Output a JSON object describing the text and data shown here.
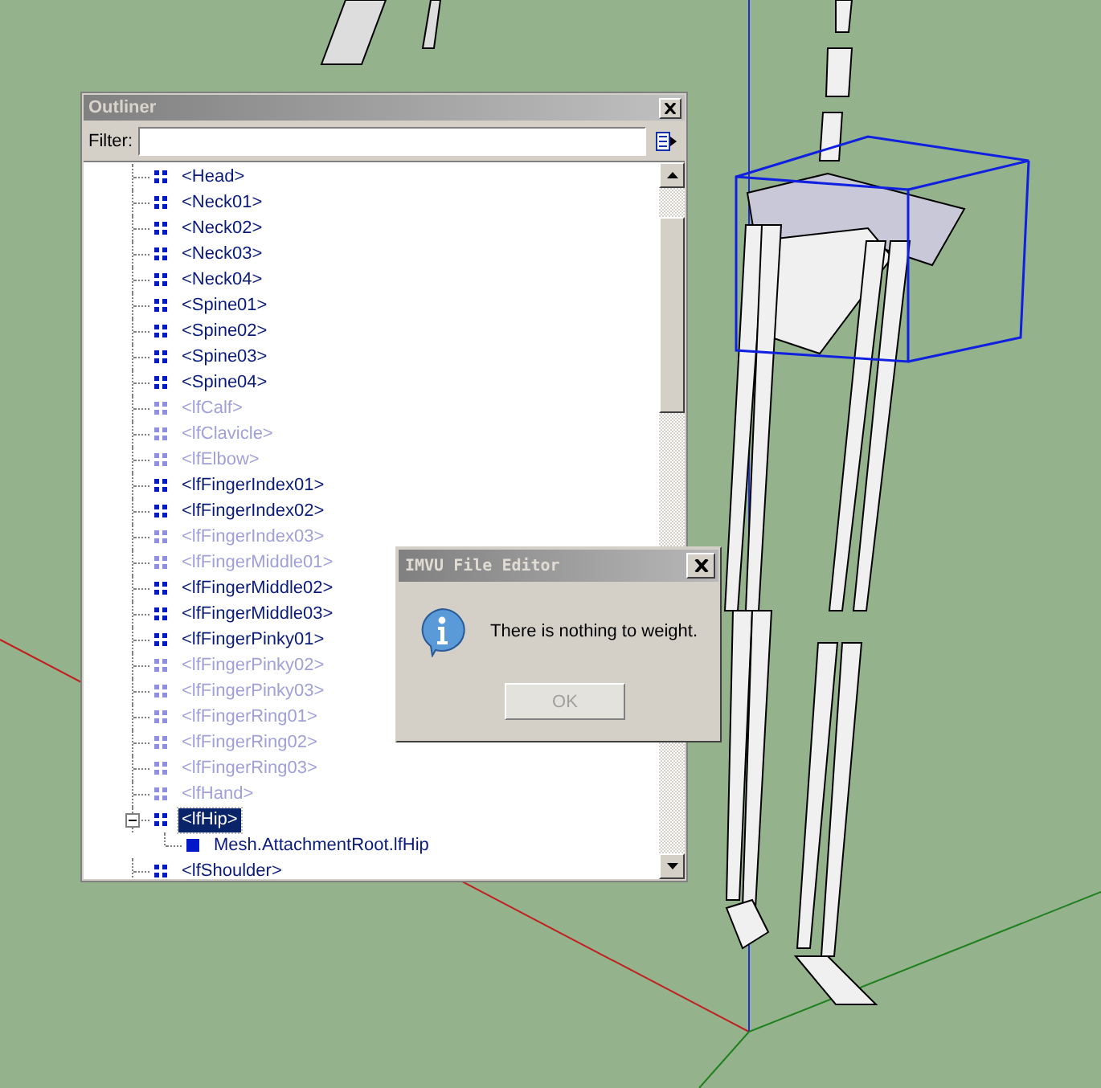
{
  "outliner": {
    "title": "Outliner",
    "filter": {
      "label": "Filter:"
    },
    "items": [
      {
        "label": "<Head>",
        "hidden": false,
        "selected": false
      },
      {
        "label": "<Neck01>",
        "hidden": false,
        "selected": false
      },
      {
        "label": "<Neck02>",
        "hidden": false,
        "selected": false
      },
      {
        "label": "<Neck03>",
        "hidden": false,
        "selected": false
      },
      {
        "label": "<Neck04>",
        "hidden": false,
        "selected": false
      },
      {
        "label": "<Spine01>",
        "hidden": false,
        "selected": false
      },
      {
        "label": "<Spine02>",
        "hidden": false,
        "selected": false
      },
      {
        "label": "<Spine03>",
        "hidden": false,
        "selected": false
      },
      {
        "label": "<Spine04>",
        "hidden": false,
        "selected": false
      },
      {
        "label": "<lfCalf>",
        "hidden": true,
        "selected": false
      },
      {
        "label": "<lfClavicle>",
        "hidden": true,
        "selected": false
      },
      {
        "label": "<lfElbow>",
        "hidden": true,
        "selected": false
      },
      {
        "label": "<lfFingerIndex01>",
        "hidden": false,
        "selected": false
      },
      {
        "label": "<lfFingerIndex02>",
        "hidden": false,
        "selected": false
      },
      {
        "label": "<lfFingerIndex03>",
        "hidden": true,
        "selected": false
      },
      {
        "label": "<lfFingerMiddle01>",
        "hidden": true,
        "selected": false
      },
      {
        "label": "<lfFingerMiddle02>",
        "hidden": false,
        "selected": false
      },
      {
        "label": "<lfFingerMiddle03>",
        "hidden": false,
        "selected": false
      },
      {
        "label": "<lfFingerPinky01>",
        "hidden": false,
        "selected": false
      },
      {
        "label": "<lfFingerPinky02>",
        "hidden": true,
        "selected": false
      },
      {
        "label": "<lfFingerPinky03>",
        "hidden": true,
        "selected": false
      },
      {
        "label": "<lfFingerRing01>",
        "hidden": true,
        "selected": false
      },
      {
        "label": "<lfFingerRing02>",
        "hidden": true,
        "selected": false
      },
      {
        "label": "<lfFingerRing03>",
        "hidden": true,
        "selected": false
      },
      {
        "label": "<lfHand>",
        "hidden": true,
        "selected": false
      },
      {
        "label": "<lfHip>",
        "hidden": false,
        "selected": true,
        "expanded": true,
        "children": [
          {
            "label": "Mesh.AttachmentRoot.lfHip",
            "hidden": false,
            "selected": false
          }
        ]
      },
      {
        "label": "<lfShoulder>",
        "hidden": false,
        "selected": false
      }
    ]
  },
  "dialog": {
    "title": "IMVU File Editor",
    "message": "There is nothing to weight.",
    "button": {
      "label": "OK",
      "disabled": true
    }
  }
}
